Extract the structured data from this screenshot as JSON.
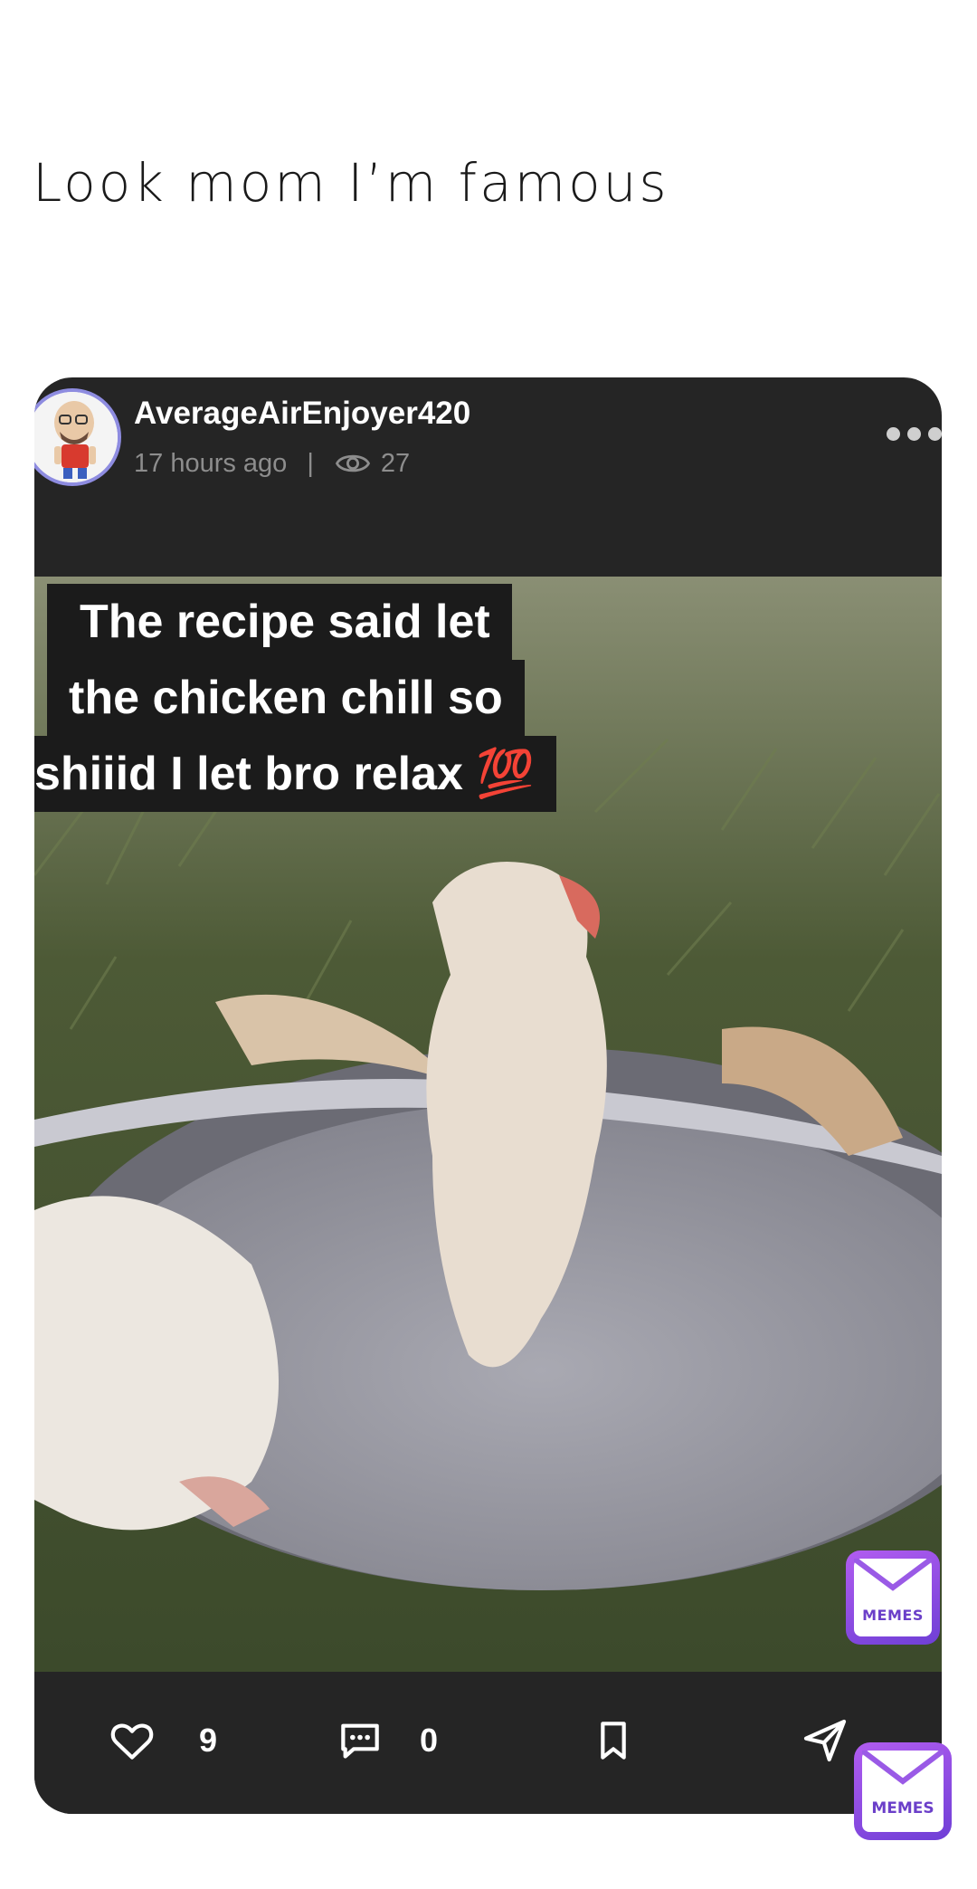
{
  "post": {
    "caption": "Look mom I’m famous"
  },
  "card": {
    "username": "AverageAirEnjoyer420",
    "time_ago": "17 hours ago",
    "separator": "|",
    "views": "27",
    "avatar_icon": "avatar-cartoon-icon",
    "more_icon": "more-dots-icon"
  },
  "meme": {
    "lines": [
      "The recipe said let",
      "the chicken chill so",
      "shiiid I let bro relax 💯"
    ],
    "watermark": "MEMES"
  },
  "actions": {
    "likes": "9",
    "comments": "0",
    "like_icon": "heart-icon",
    "comment_icon": "comment-icon",
    "save_icon": "bookmark-icon",
    "share_icon": "send-icon"
  },
  "app_logo": "MEMES",
  "colors": {
    "card_bg": "#252525",
    "brand_purple": "#8b4fe0",
    "meta_gray": "#8d8d8d"
  }
}
